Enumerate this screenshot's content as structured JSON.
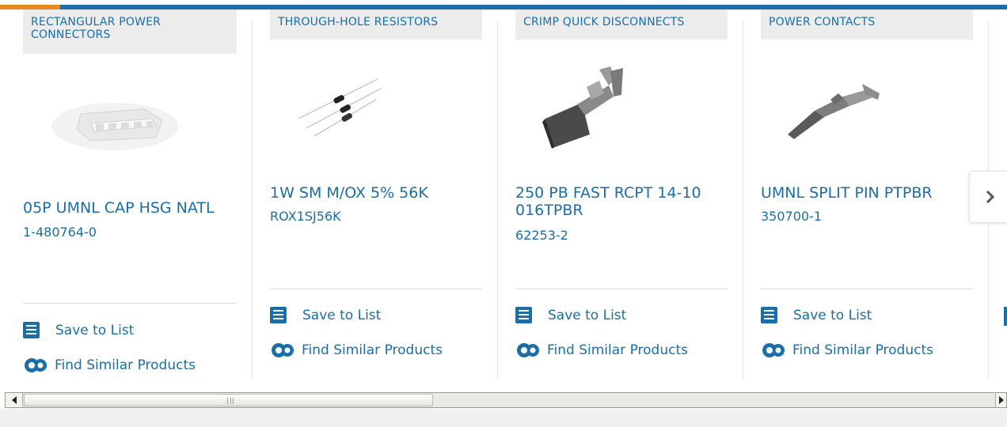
{
  "cards": [
    {
      "category": "RECTANGULAR POWER CONNECTORS",
      "title": "05P UMNL CAP HSG NATL",
      "part_number": "1-480764-0",
      "save_label": "Save to List",
      "similar_label": "Find Similar Products",
      "image_icon": "connector-housing-icon"
    },
    {
      "category": "THROUGH-HOLE RESISTORS",
      "title": "1W SM M/OX 5% 56K",
      "part_number": "ROX1SJ56K",
      "save_label": "Save to List",
      "similar_label": "Find Similar Products",
      "image_icon": "resistor-icon"
    },
    {
      "category": "CRIMP QUICK DISCONNECTS",
      "title": "250 PB FAST RCPT 14-10 016TPBR",
      "part_number": "62253-2",
      "save_label": "Save to List",
      "similar_label": "Find Similar Products",
      "image_icon": "crimp-terminal-icon"
    },
    {
      "category": "POWER CONTACTS",
      "title": "UMNL SPLIT PIN PTPBR",
      "part_number": "350700-1",
      "save_label": "Save to List",
      "similar_label": "Find Similar Products",
      "image_icon": "pin-contact-icon"
    }
  ],
  "next_button_icon": "chevron-right-icon",
  "colors": {
    "brand_blue": "#1b6ea8",
    "accent_orange": "#e8891e"
  }
}
